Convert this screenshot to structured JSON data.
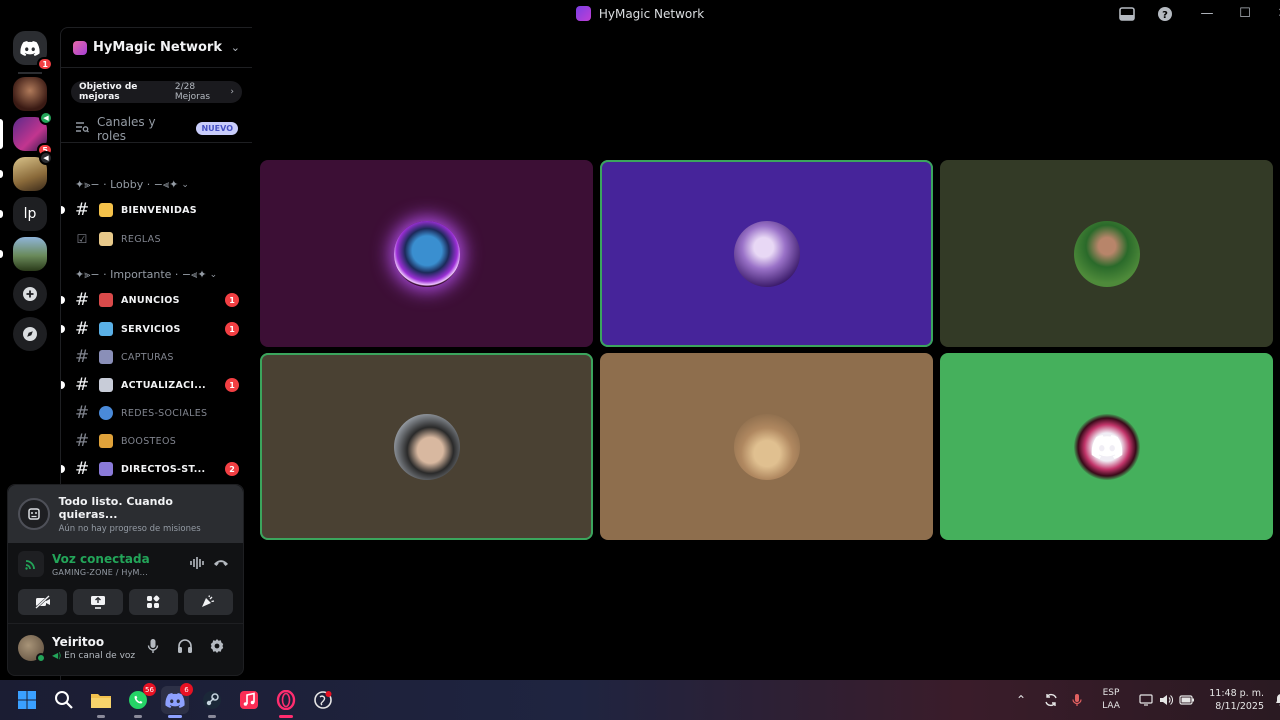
{
  "window": {
    "title": "HyMagic Network",
    "controls": [
      "_",
      "□",
      "✕"
    ]
  },
  "rail": {
    "home_badge": "1",
    "servers": [
      {
        "name": "server-1",
        "badge": ""
      },
      {
        "name": "hymagic",
        "badge": "5"
      },
      {
        "name": "server-3",
        "badge": ""
      },
      {
        "name": "lp",
        "label": "lp",
        "badge": ""
      },
      {
        "name": "server-5",
        "badge": ""
      }
    ]
  },
  "sidebar": {
    "server_name": "HyMagic Network",
    "boost": {
      "label": "Objetivo de mejoras",
      "progress": "2/28 Mejoras"
    },
    "channels_roles": {
      "label": "Canales y roles",
      "new_badge": "NUEVO"
    },
    "categories": [
      {
        "label": "✦⫸− · Lobby · −⫷✦"
      },
      {
        "label": "✦⫸− · Importante · −⫷✦"
      }
    ],
    "channels": [
      {
        "label": "BIENVENIDAS",
        "unread": true,
        "count": ""
      },
      {
        "label": "REGLAS",
        "unread": false,
        "count": ""
      },
      {
        "label": "ANUNCIOS",
        "unread": true,
        "count": "1"
      },
      {
        "label": "SERVICIOS",
        "unread": true,
        "count": "1"
      },
      {
        "label": "CAPTURAS",
        "unread": false,
        "count": ""
      },
      {
        "label": "ACTUALIZACI...",
        "unread": true,
        "count": "1"
      },
      {
        "label": "REDES-SOCIALES",
        "unread": false,
        "count": ""
      },
      {
        "label": "BOOSTEOS",
        "unread": false,
        "count": ""
      },
      {
        "label": "DIRECTOS-ST...",
        "unread": true,
        "count": "2"
      }
    ]
  },
  "quest": {
    "title": "Todo listo. Cuando quieras...",
    "subtitle": "Aún no hay progreso de misiones"
  },
  "voice": {
    "status": "Voz conectada",
    "channel": "GAMING-ZONE / HyM..."
  },
  "user": {
    "name": "Yeiritoo",
    "status": "En canal de voz"
  },
  "stage": {
    "tiles": [
      {
        "name": "tile-1",
        "bg": "#3c0f35",
        "speaking": false
      },
      {
        "name": "tile-2",
        "bg": "#46249a",
        "speaking": true
      },
      {
        "name": "tile-3",
        "bg": "#333a26",
        "speaking": false
      },
      {
        "name": "tile-4",
        "bg": "#4a4133",
        "speaking": true
      },
      {
        "name": "tile-5",
        "bg": "#8e6e4d",
        "speaking": false
      },
      {
        "name": "tile-6",
        "bg": "#45b05c",
        "speaking": false
      }
    ]
  },
  "taskbar": {
    "whatsapp_badge": "56",
    "discord_badge": "6",
    "tray": {
      "lang_top": "ESP",
      "lang_bottom": "LAA",
      "time": "11:48 p. m.",
      "date": "8/11/2025"
    }
  },
  "colors": {
    "accent_green": "#23a559",
    "badge_red": "#f23f43",
    "new_badge": "#c9cdfb"
  }
}
